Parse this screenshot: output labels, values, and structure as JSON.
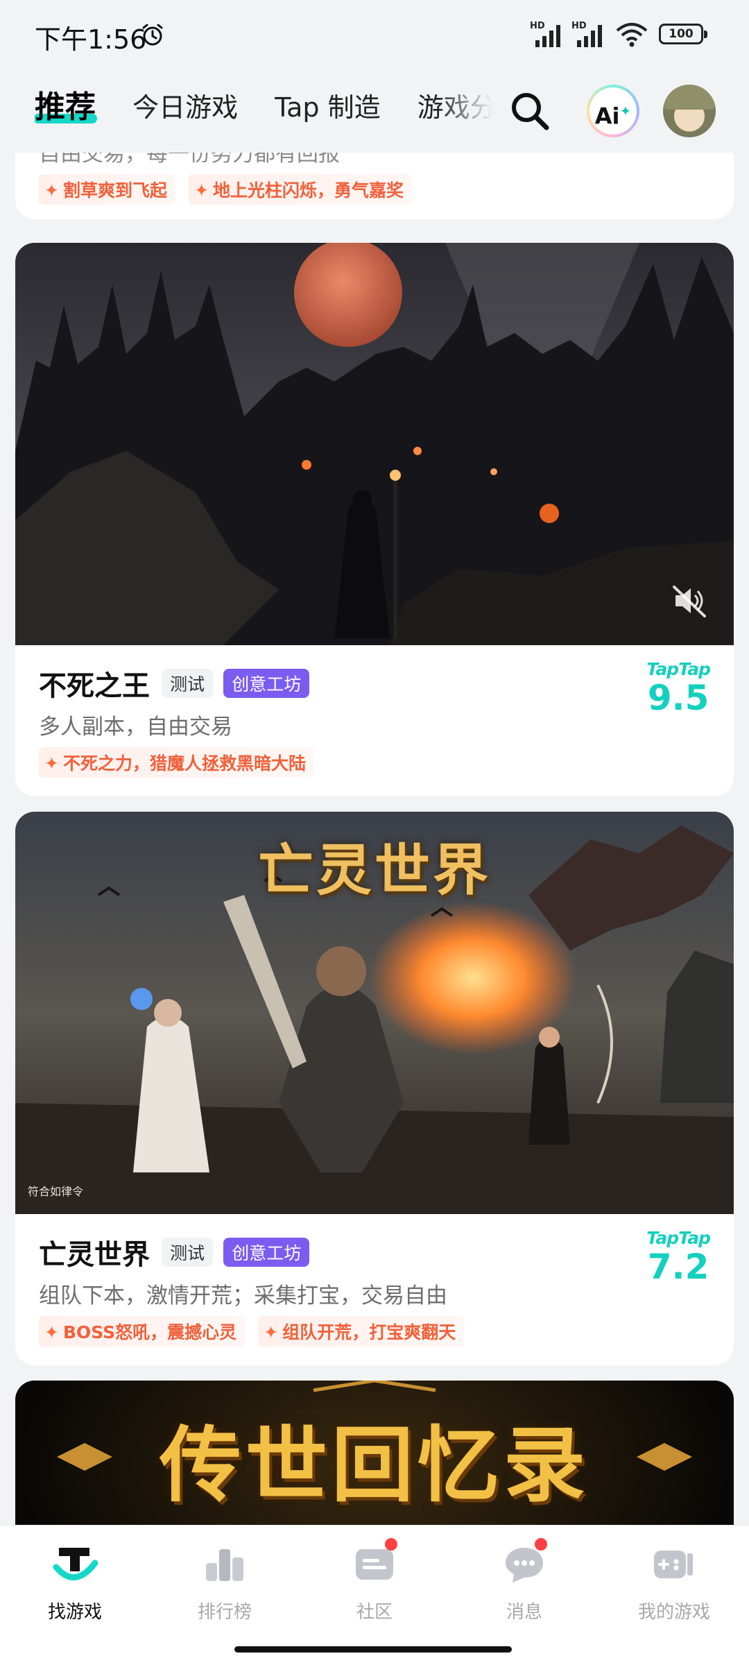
{
  "status_bar": {
    "time": "下午1:56",
    "battery": "100",
    "network_label": "HD"
  },
  "top_nav": {
    "tabs": [
      {
        "label": "推荐",
        "active": true
      },
      {
        "label": "今日游戏",
        "active": false
      },
      {
        "label": "Tap 制造",
        "active": false
      },
      {
        "label": "游戏分类",
        "active": false
      }
    ],
    "ai_label": "Ai"
  },
  "feed": {
    "partial_card": {
      "desc": "自由交易，每一份努力都有回报",
      "tags": [
        "割草爽到飞起",
        "地上光柱闪烁，勇气嘉奖"
      ]
    },
    "cards": [
      {
        "title": "不死之王",
        "badge_test": "测试",
        "badge_workshop": "创意工坊",
        "desc": "多人副本，自由交易",
        "tags": [
          "不死之力，猎魔人拯救黑暗大陆"
        ],
        "platform": "TapTap",
        "score": "9.5",
        "muted": true
      },
      {
        "title": "亡灵世界",
        "badge_test": "测试",
        "badge_workshop": "创意工坊",
        "desc": "组队下本，激情开荒；采集打宝，交易自由",
        "tags": [
          "BOSS怒吼，震撼心灵",
          "组队开荒，打宝爽翻天"
        ],
        "platform": "TapTap",
        "score": "7.2",
        "banner_text": "亡灵世界",
        "watermark": "符合如律令"
      },
      {
        "banner_text": "传世回忆录"
      }
    ]
  },
  "bottom_nav": {
    "items": [
      {
        "label": "找游戏",
        "icon": "find-game-icon",
        "active": true
      },
      {
        "label": "排行榜",
        "icon": "ranking-icon",
        "active": false
      },
      {
        "label": "社区",
        "icon": "community-icon",
        "active": false,
        "dot": true
      },
      {
        "label": "消息",
        "icon": "message-icon",
        "active": false,
        "dot": true
      },
      {
        "label": "我的游戏",
        "icon": "my-games-icon",
        "active": false
      }
    ]
  },
  "colors": {
    "accent": "#14d0be",
    "workshop": "#7b5cf0",
    "tag_text": "#f0613b"
  }
}
